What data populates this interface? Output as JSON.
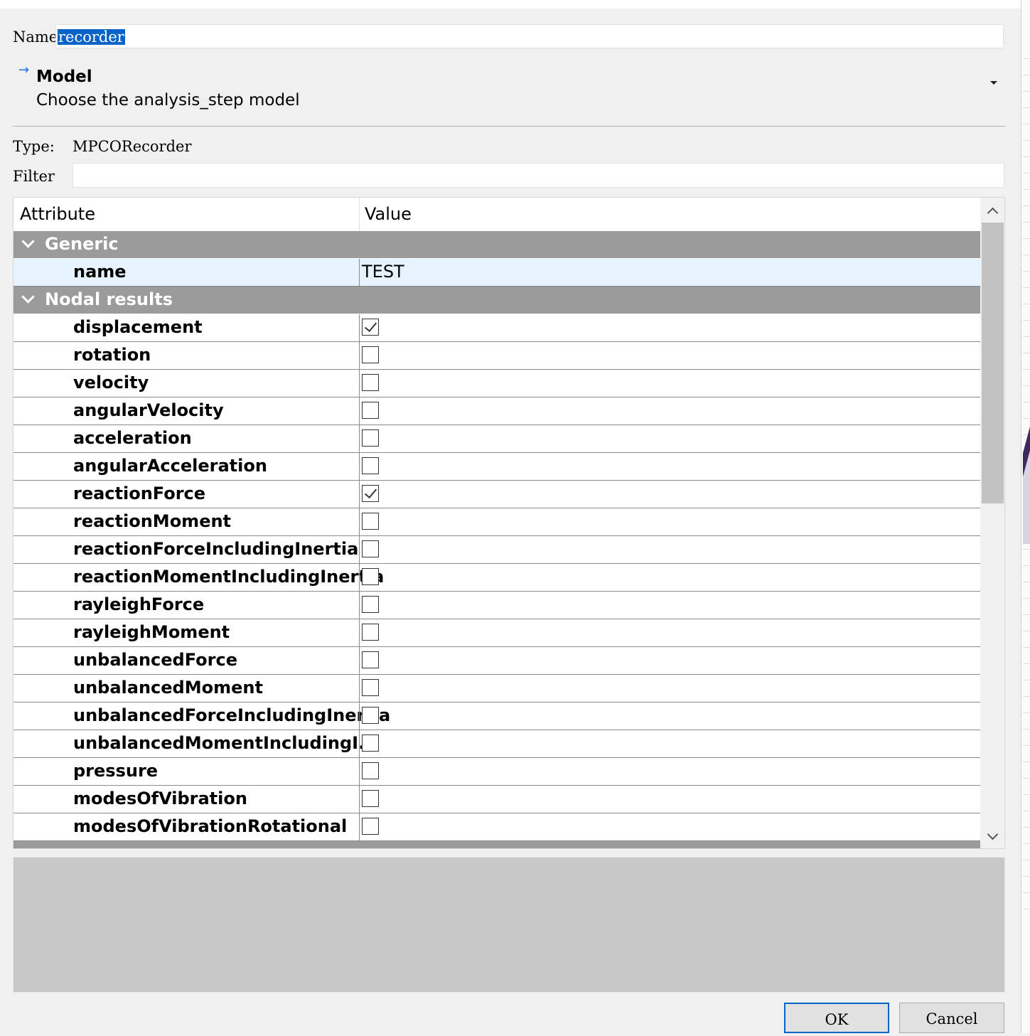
{
  "dialog": {
    "name_label": "Name",
    "name_value": "recorder",
    "model": {
      "arrow_icon": "→",
      "title": "Model",
      "description": "Choose the analysis_step model"
    },
    "type_label": "Type:",
    "type_value": "MPCORecorder",
    "filter_label": "Filter",
    "filter_value": ""
  },
  "table": {
    "headers": {
      "attribute": "Attribute",
      "value": "Value"
    },
    "groups": [
      {
        "label": "Generic",
        "rows": [
          {
            "attr": "name",
            "value": "TEST",
            "selected": true
          }
        ]
      },
      {
        "label": "Nodal results",
        "rows": [
          {
            "attr": "displacement",
            "checked": true
          },
          {
            "attr": "rotation",
            "checked": false
          },
          {
            "attr": "velocity",
            "checked": false
          },
          {
            "attr": "angularVelocity",
            "checked": false
          },
          {
            "attr": "acceleration",
            "checked": false
          },
          {
            "attr": "angularAcceleration",
            "checked": false
          },
          {
            "attr": "reactionForce",
            "checked": true
          },
          {
            "attr": "reactionMoment",
            "checked": false
          },
          {
            "attr": "reactionForceIncludingInertia",
            "checked": false
          },
          {
            "attr": "reactionMomentIncludingInertia",
            "checked": false
          },
          {
            "attr": "rayleighForce",
            "checked": false
          },
          {
            "attr": "rayleighMoment",
            "checked": false
          },
          {
            "attr": "unbalancedForce",
            "checked": false
          },
          {
            "attr": "unbalancedMoment",
            "checked": false
          },
          {
            "attr": "unbalancedForceIncludingInertia",
            "checked": false
          },
          {
            "attr": "unbalancedMomentIncludingI...",
            "checked": false
          },
          {
            "attr": "pressure",
            "checked": false
          },
          {
            "attr": "modesOfVibration",
            "checked": false
          },
          {
            "attr": "modesOfVibrationRotational",
            "checked": false
          }
        ]
      }
    ]
  },
  "buttons": {
    "ok": "OK",
    "cancel": "Cancel"
  }
}
